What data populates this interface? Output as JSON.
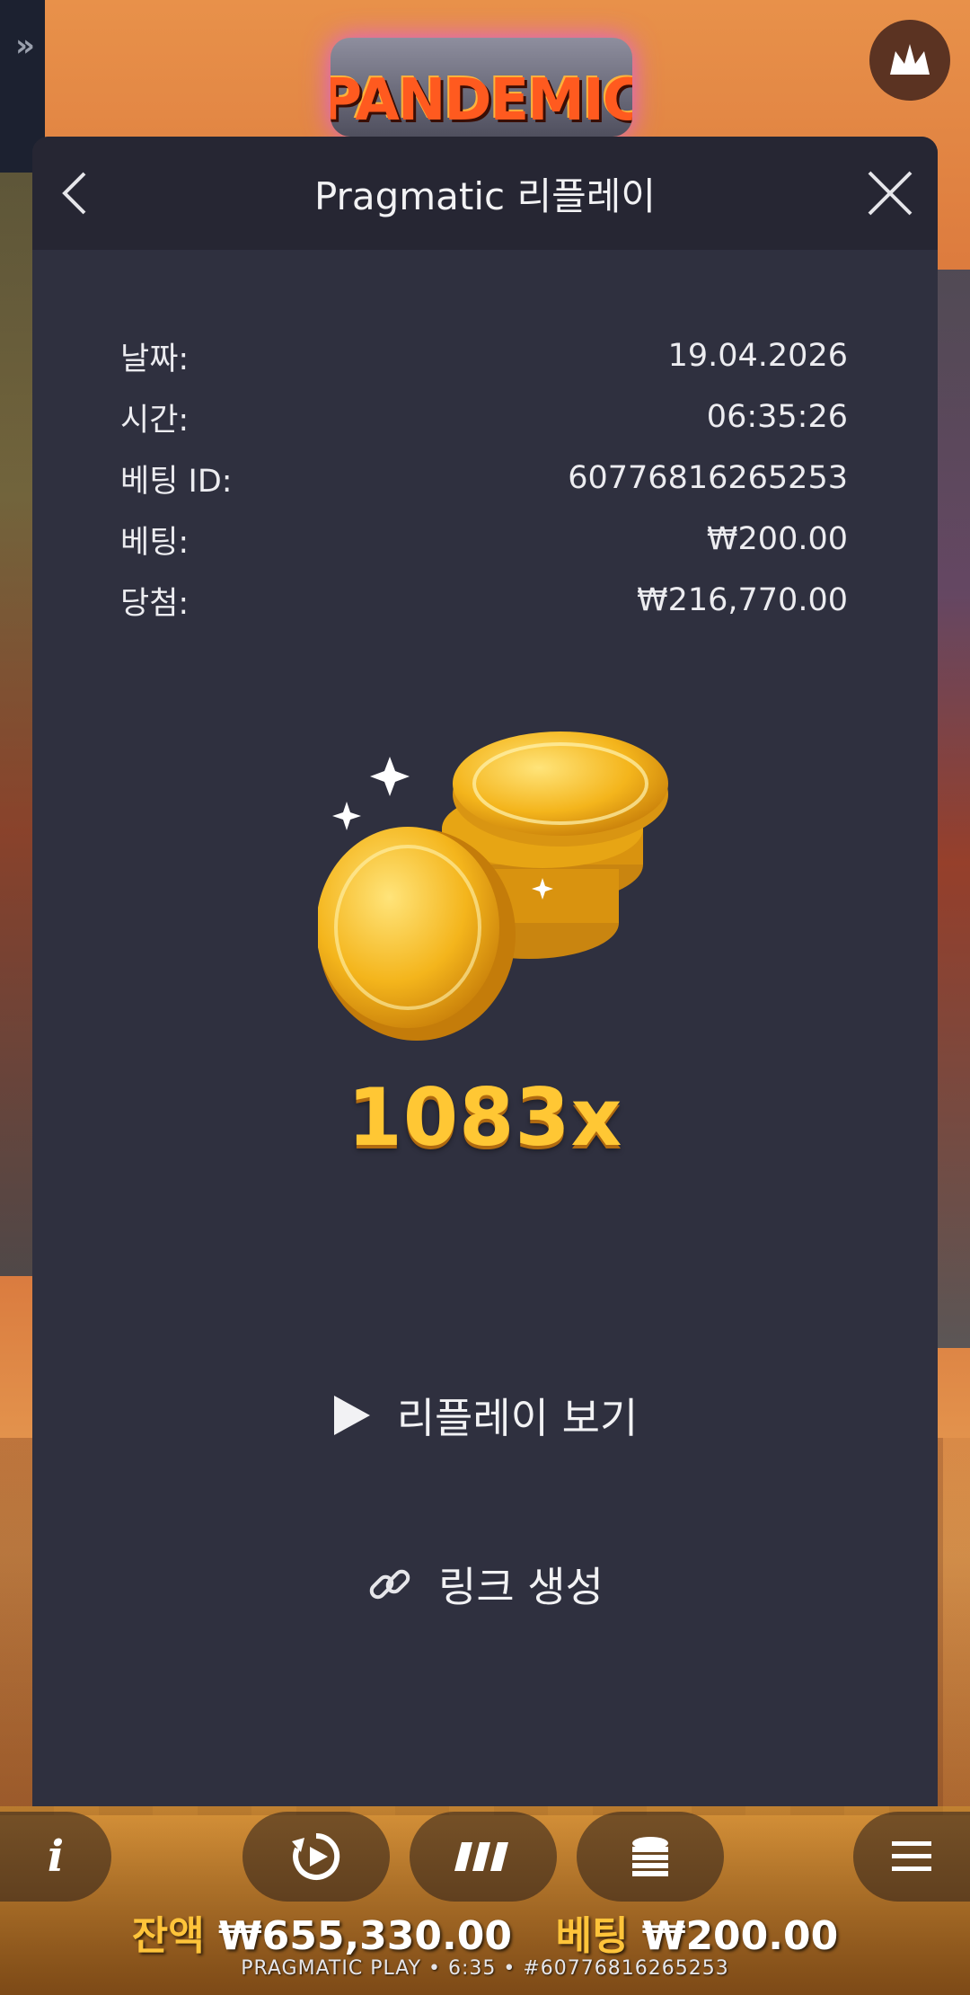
{
  "background": {
    "game_logo": "PANDEMIC",
    "side_tab_icon": "double-chevron-right-icon",
    "crown_icon": "crown-icon"
  },
  "modal": {
    "title": "Pragmatic 리플레이",
    "back_icon": "chevron-left-icon",
    "close_icon": "close-icon",
    "details": [
      {
        "label": "날짜:",
        "value": "19.04.2026"
      },
      {
        "label": "시간:",
        "value": "06:35:26"
      },
      {
        "label": "베팅 ID:",
        "value": "60776816265253"
      },
      {
        "label": "베팅:",
        "value": "₩200.00"
      },
      {
        "label": "당첨:",
        "value": "₩216,770.00"
      }
    ],
    "coins_icon": "gold-coins-icon",
    "multiplier": "1083x",
    "replay_label": "리플레이 보기",
    "replay_icon": "play-icon",
    "link_label": "링크 생성",
    "link_icon": "link-icon"
  },
  "bottom": {
    "controls": [
      {
        "icon": "info-icon",
        "glyph": "i"
      },
      {
        "icon": "autoplay-icon"
      },
      {
        "icon": "turbo-icon"
      },
      {
        "icon": "bet-coins-icon"
      },
      {
        "icon": "menu-icon"
      }
    ],
    "balance_label": "잔액",
    "balance_value": "₩655,330.00",
    "bet_label": "베팅",
    "bet_value": "₩200.00",
    "footer": "PRAGMATIC PLAY • 6:35 • #60776816265253"
  },
  "colors": {
    "modal_bg": "#2f303f",
    "header_bg": "#262633",
    "multiplier": "#ffc734",
    "balance_label": "#ffc43a"
  }
}
